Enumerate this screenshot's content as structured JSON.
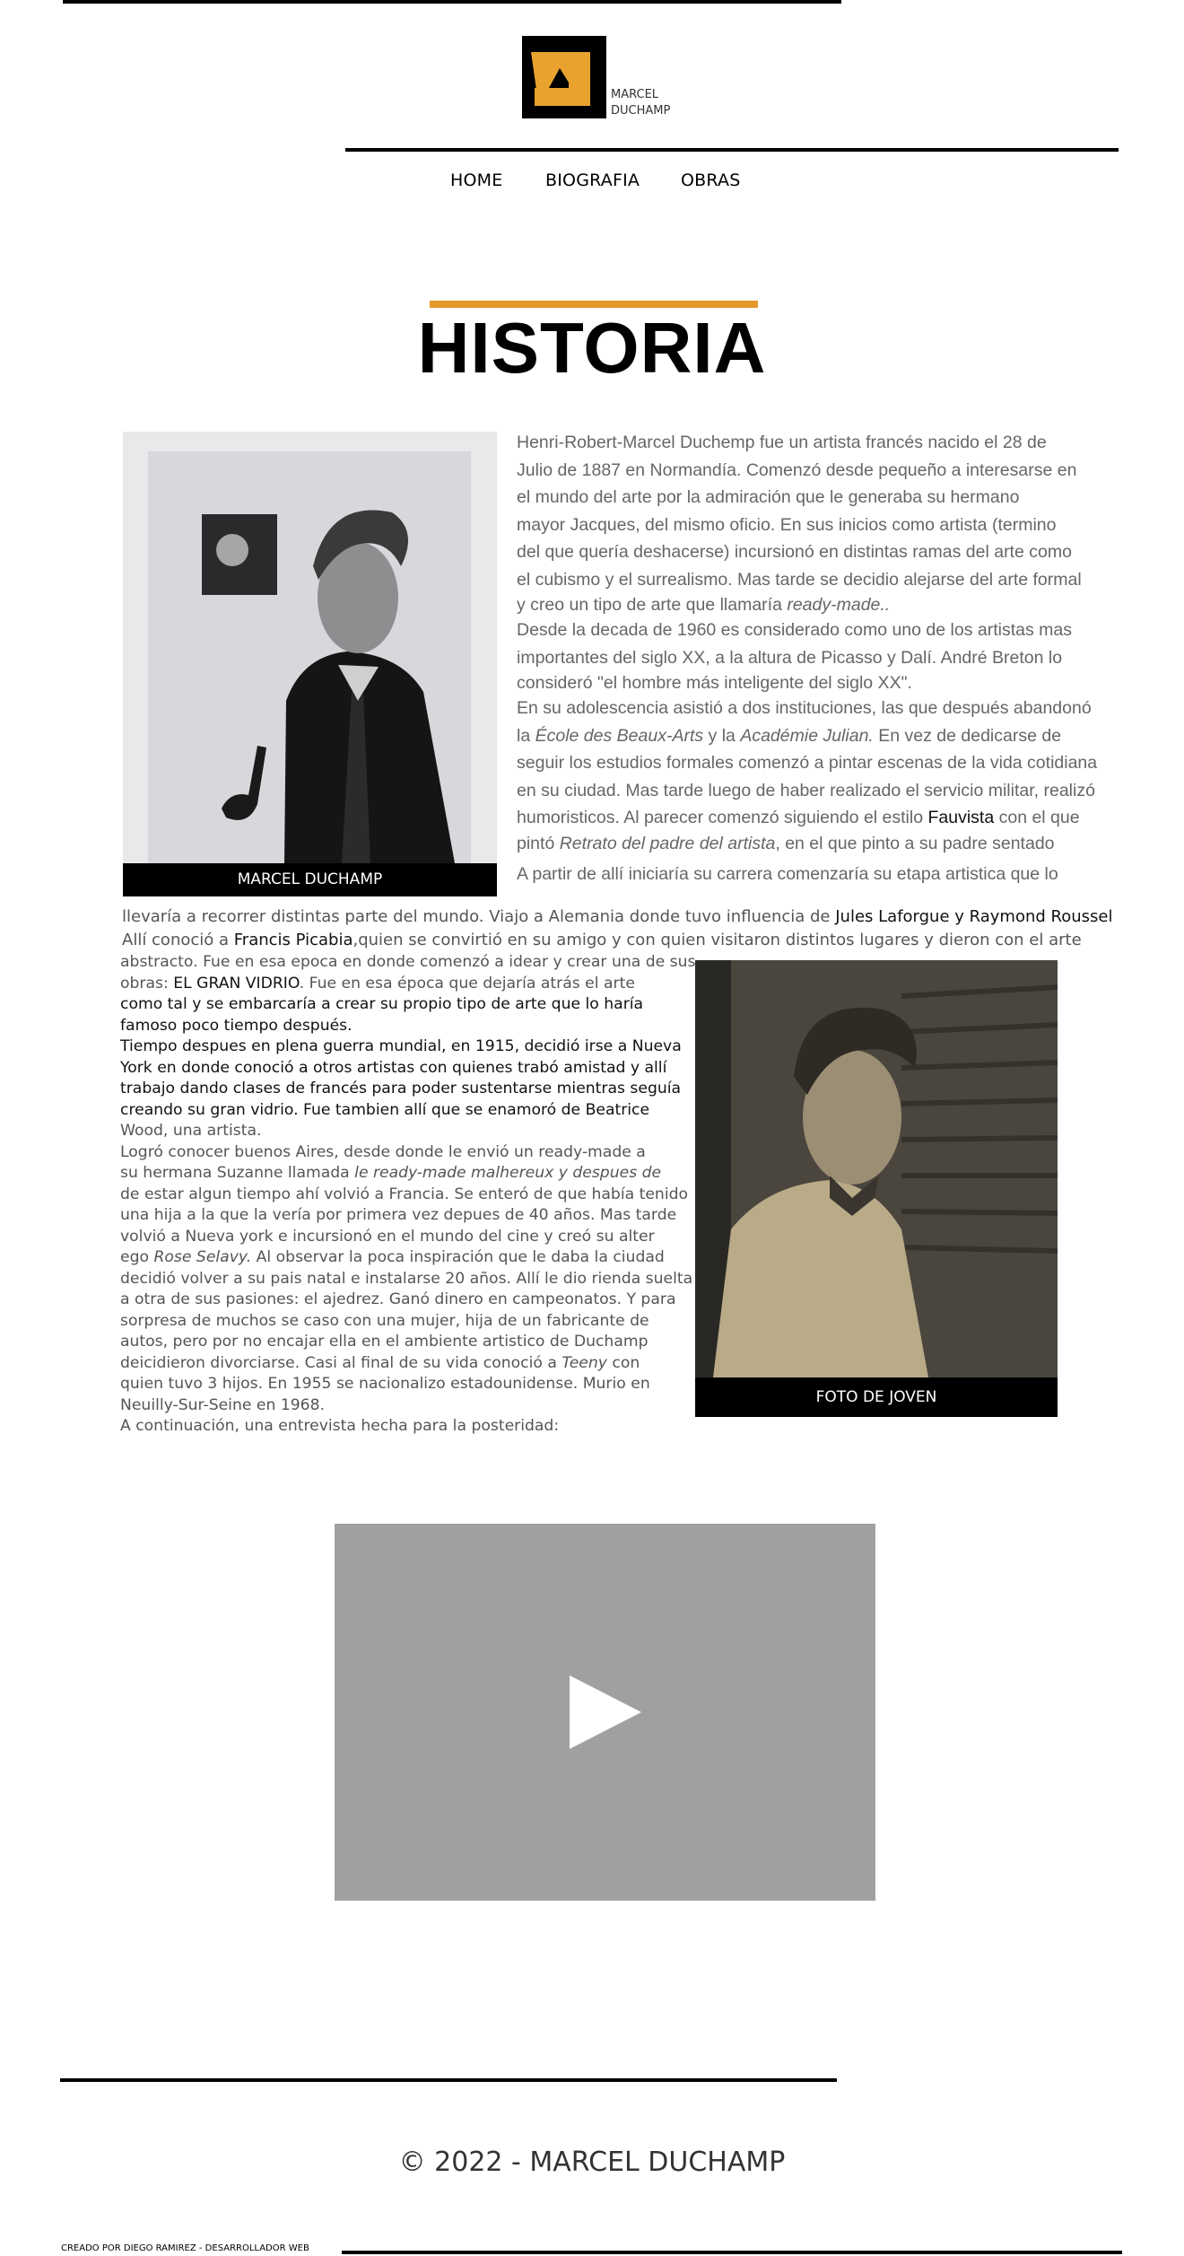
{
  "brand": {
    "logo_text_line1": "MARCEL",
    "logo_text_line2": "DUCHAMP",
    "accent_color": "#e5992a"
  },
  "nav": {
    "items": [
      "HOME",
      "BIOGRAFIA",
      "OBRAS"
    ]
  },
  "page": {
    "title": "HISTORIA"
  },
  "photos": {
    "portrait_caption": "MARCEL DUCHAMP",
    "young_caption": "FOTO DE JOVEN"
  },
  "bio_top": [
    "Henri-Robert-Marcel Duchemp fue un artista francés nacido el 28 de",
    "Julio de 1887 en Normandía. Comenzó desde pequeño a interesarse en",
    "el mundo del arte por la admiración que le generaba su hermano",
    "mayor Jacques, del mismo oficio. En sus inicios como artista (termino",
    "del que quería deshacerse) incursionó en distintas ramas del arte como",
    "el cubismo y el surrealismo.  Mas tarde se decidio alejarse  del arte formal",
    "y creo un tipo de arte que llamaría",
    "ready-made..",
    "Desde la decada de 1960 es considerado como uno de los artistas mas",
    "importantes del siglo XX,  a la altura de Picasso y Dalí. André Breton lo",
    "consideró \"el hombre más inteligente del siglo XX\".",
    "En su adolescencia asistió a dos  instituciones, las que después abandonó",
    "la",
    "École des Beaux-Arts",
    "y la",
    "Académie Julian.",
    " En vez de dedicarse de",
    "seguir los estudios formales comenzó a pintar escenas de la vida cotidiana",
    "en su ciudad. Mas tarde luego de haber realizado el servicio militar, realizó",
    "humoristicos. Al parecer comenzó siguiendo el estilo",
    "Fauvista",
    "con el que",
    "pintó",
    "Retrato del padre del artista",
    ", en el que pinto a su padre sentado",
    " A partir de allí iniciaría su carrera comenzaría su etapa artistica que lo"
  ],
  "bio_mid": {
    "line1_a": "llevaría a recorrer distintas parte del mundo. Viajo a Alemania donde tuvo influencia de",
    "line1_b": "Jules Laforgue y Raymond Roussel",
    "line2_a": "Allí conoció a",
    "line2_b": "Francis Picabia",
    "line2_c": ",quien se convirtió en su amigo y con quien visitaron distintos lugares y dieron con el arte"
  },
  "bio_bottom": [
    "abstracto. Fue en esa epoca en donde comenzó a idear y crear una de sus",
    "obras:",
    "EL GRAN VIDRIO",
    ". Fue en esa época que dejaría atrás el arte",
    "como tal y se embarcaría a crear su propio tipo de arte que lo haría",
    "famoso poco tiempo después.",
    "Tiempo despues en plena guerra mundial, en 1915, decidió irse a Nueva",
    "York en donde conoció a otros artistas con quienes trabó amistad y allí",
    "trabajo dando clases de francés para poder sustentarse mientras seguía",
    "creando su gran vidrio. Fue tambien allí que se enamoró de Beatrice",
    "Wood, una artista.",
    "Logró conocer buenos Aires, desde donde le envió un ready-made a",
    "su hermana Suzanne llamada",
    "le ready-made malhereux y despues de",
    "de estar algun tiempo ahí volvió a Francia. Se enteró de que había tenido",
    "una hija a la que la vería por primera vez depues de 40 años. Mas tarde",
    "volvió a Nueva york e incursionó en el mundo del cine y creó su alter",
    "ego",
    "Rose Selavy.",
    " Al observar la poca inspiración que le daba la ciudad",
    "decidió volver a su pais natal e instalarse 20 años. Allí le dio rienda suelta",
    "a otra de sus pasiones: el ajedrez. Ganó dinero en campeonatos. Y para",
    "sorpresa de muchos se caso con una mujer, hija de un fabricante de",
    "autos, pero por no encajar ella en el ambiente artistico de Duchamp",
    "deicidieron divorciarse. Casi al final de su vida conoció a",
    "Teeny",
    " con",
    "quien tuvo 3 hijos. En 1955 se nacionalizo estadounidense. Murio en",
    "Neuilly-Sur-Seine en 1968.",
    " A continuación, una entrevista hecha para la posteridad:"
  ],
  "video": {
    "icon": "play-icon"
  },
  "footer": {
    "copyright_symbol": "©",
    "copyright": " 2022 - MARCEL DUCHAMP",
    "credit": "CREADO POR DIEGO RAMIREZ - DESARROLLADOR WEB"
  }
}
